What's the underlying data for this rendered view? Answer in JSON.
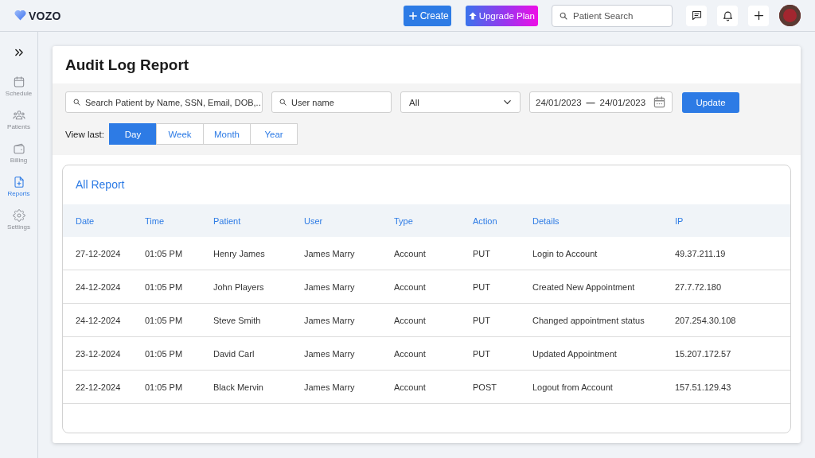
{
  "header": {
    "logo": "VOZO",
    "create_button": "Create",
    "upgrade_button": "Upgrade Plan",
    "search": {
      "placeholder": "Patient Search"
    }
  },
  "sidebar": {
    "items": [
      {
        "label": "Schedule",
        "selected": false
      },
      {
        "label": "Patients",
        "selected": false
      },
      {
        "label": "Billing",
        "selected": false
      },
      {
        "label": "Reports",
        "selected": true
      },
      {
        "label": "Settings",
        "selected": false
      }
    ]
  },
  "page": {
    "title": "Audit Log Report"
  },
  "filters": {
    "patient_search": {
      "placeholder": "Search Patient by Name, SSN, Email, DOB,.."
    },
    "user_search": {
      "placeholder": "User name"
    },
    "type_select": {
      "value": "All"
    },
    "date_range": {
      "start": "24/01/2023",
      "separator": "—",
      "end": "24/01/2023"
    },
    "update_button": "Update",
    "view_last": {
      "label": "View last:",
      "options": [
        {
          "label": "Day",
          "selected": true
        },
        {
          "label": "Week",
          "selected": false
        },
        {
          "label": "Month",
          "selected": false
        },
        {
          "label": "Year",
          "selected": false
        }
      ]
    }
  },
  "report": {
    "title": "All Report",
    "columns": [
      "Date",
      "Time",
      "Patient",
      "User",
      "Type",
      "Action",
      "Details",
      "IP"
    ],
    "rows": [
      [
        "27-12-2024",
        "01:05 PM",
        "Henry James",
        "James Marry",
        "Account",
        "PUT",
        "Login to Account",
        "49.37.211.19"
      ],
      [
        "24-12-2024",
        "01:05 PM",
        "John Players",
        "James Marry",
        "Account",
        "PUT",
        "Created New Appointment",
        "27.7.72.180"
      ],
      [
        "24-12-2024",
        "01:05 PM",
        "Steve Smith",
        "James Marry",
        "Account",
        "PUT",
        "Changed appointment status",
        "207.254.30.108"
      ],
      [
        "23-12-2024",
        "01:05 PM",
        "David Carl",
        "James Marry",
        "Account",
        "PUT",
        "Updated Appointment",
        "15.207.172.57"
      ],
      [
        "22-12-2024",
        "01:05 PM",
        "Black Mervin",
        "James Marry",
        "Account",
        "POST",
        "Logout from Account",
        "157.51.129.43"
      ]
    ]
  }
}
